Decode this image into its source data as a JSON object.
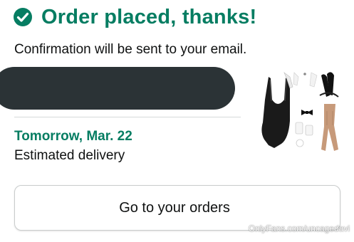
{
  "header": {
    "title": "Order placed, thanks!",
    "icon": "check-circle-icon"
  },
  "confirmation": {
    "message": "Confirmation will be sent to your email."
  },
  "delivery": {
    "date": "Tomorrow, Mar. 22",
    "label": "Estimated delivery"
  },
  "actions": {
    "orders_button_label": "Go to your orders"
  },
  "watermark": {
    "text": "OnlyFans.com/uncagedavi"
  },
  "colors": {
    "accent_green": "#067d62",
    "text": "#0f1111",
    "redaction": "#2b3336",
    "divider": "#d5d9d9"
  }
}
